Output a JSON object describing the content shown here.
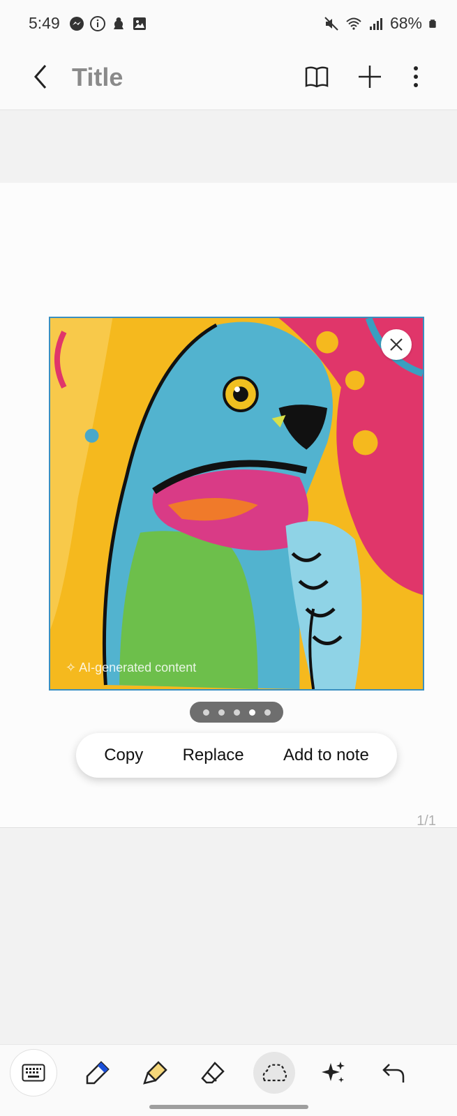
{
  "status_bar": {
    "time": "5:49",
    "battery": "68%",
    "left_icons": [
      "messenger-icon",
      "info-icon",
      "notification-icon",
      "gallery-icon"
    ],
    "right_icons": [
      "mute-icon",
      "wifi-icon",
      "signal-icon",
      "battery-icon"
    ]
  },
  "app_bar": {
    "title": "Title",
    "icons": [
      "back-icon",
      "book-icon",
      "add-icon",
      "more-options-icon"
    ]
  },
  "image": {
    "ai_label": "AI-generated content",
    "pager_total": 5,
    "pager_active_index": 3
  },
  "action_menu": {
    "copy": "Copy",
    "replace": "Replace",
    "add_to_note": "Add to note"
  },
  "page_indicator": "1/1",
  "toolbar": {
    "tools": [
      "keyboard-icon",
      "pen-icon",
      "highlighter-icon",
      "eraser-icon",
      "lasso-icon",
      "ai-sparkle-icon",
      "undo-icon"
    ],
    "selected": "lasso-icon"
  },
  "colors": {
    "accent_pen": "#1a4fd8",
    "highlighter": "#f5d77a",
    "frame_border": "#3a8fc0"
  }
}
